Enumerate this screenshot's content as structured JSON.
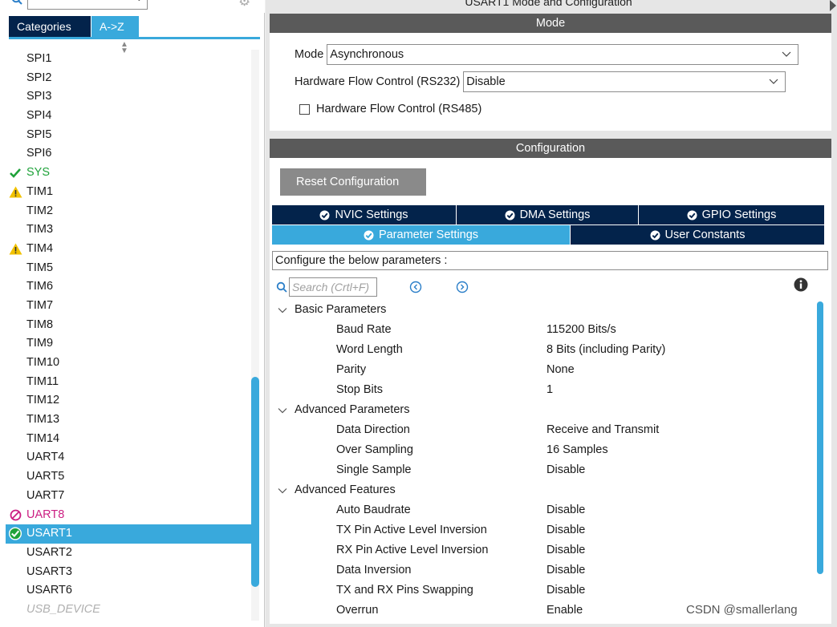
{
  "left": {
    "tabs": [
      "Categories",
      "A->Z"
    ],
    "peripherals": [
      {
        "label": "SPI1",
        "status": "none"
      },
      {
        "label": "SPI2",
        "status": "none"
      },
      {
        "label": "SPI3",
        "status": "none"
      },
      {
        "label": "SPI4",
        "status": "none"
      },
      {
        "label": "SPI5",
        "status": "none"
      },
      {
        "label": "SPI6",
        "status": "none"
      },
      {
        "label": "SYS",
        "status": "ok"
      },
      {
        "label": "TIM1",
        "status": "warning"
      },
      {
        "label": "TIM2",
        "status": "none"
      },
      {
        "label": "TIM3",
        "status": "none"
      },
      {
        "label": "TIM4",
        "status": "warning"
      },
      {
        "label": "TIM5",
        "status": "none"
      },
      {
        "label": "TIM6",
        "status": "none"
      },
      {
        "label": "TIM7",
        "status": "none"
      },
      {
        "label": "TIM8",
        "status": "none"
      },
      {
        "label": "TIM9",
        "status": "none"
      },
      {
        "label": "TIM10",
        "status": "none"
      },
      {
        "label": "TIM11",
        "status": "none"
      },
      {
        "label": "TIM12",
        "status": "none"
      },
      {
        "label": "TIM13",
        "status": "none"
      },
      {
        "label": "TIM14",
        "status": "none"
      },
      {
        "label": "UART4",
        "status": "none"
      },
      {
        "label": "UART5",
        "status": "none"
      },
      {
        "label": "UART7",
        "status": "none"
      },
      {
        "label": "UART8",
        "status": "error"
      },
      {
        "label": "USART1",
        "status": "selected"
      },
      {
        "label": "USART2",
        "status": "none"
      },
      {
        "label": "USART3",
        "status": "none"
      },
      {
        "label": "USART6",
        "status": "none"
      },
      {
        "label": "USB_DEVICE",
        "status": "disabled"
      }
    ]
  },
  "right": {
    "title": "USART1 Mode and Configuration",
    "mode_header": "Mode",
    "mode": {
      "label": "Mode",
      "value": "Asynchronous"
    },
    "hw_flow_rs232": {
      "label": "Hardware Flow Control (RS232)",
      "value": "Disable"
    },
    "hw_flow_rs485": {
      "label": "Hardware Flow Control (RS485)",
      "checked": false
    },
    "config_header": "Configuration",
    "reset_button": "Reset Configuration",
    "tabs_row1": [
      {
        "label": "NVIC Settings",
        "active": false
      },
      {
        "label": "DMA Settings",
        "active": false
      },
      {
        "label": "GPIO Settings",
        "active": false
      }
    ],
    "tabs_row2": [
      {
        "label": "Parameter Settings",
        "active": true
      },
      {
        "label": "User Constants",
        "active": false
      }
    ],
    "configure_label": "Configure the below parameters :",
    "search_placeholder": "Search (Crtl+F)",
    "groups": [
      {
        "name": "Basic Parameters",
        "params": [
          {
            "name": "Baud Rate",
            "value": "115200 Bits/s"
          },
          {
            "name": "Word Length",
            "value": "8 Bits (including Parity)"
          },
          {
            "name": "Parity",
            "value": "None"
          },
          {
            "name": "Stop Bits",
            "value": "1"
          }
        ]
      },
      {
        "name": "Advanced Parameters",
        "params": [
          {
            "name": "Data Direction",
            "value": "Receive and Transmit"
          },
          {
            "name": "Over Sampling",
            "value": "16 Samples"
          },
          {
            "name": "Single Sample",
            "value": "Disable"
          }
        ]
      },
      {
        "name": "Advanced Features",
        "params": [
          {
            "name": "Auto Baudrate",
            "value": "Disable"
          },
          {
            "name": "TX Pin Active Level Inversion",
            "value": "Disable"
          },
          {
            "name": "RX Pin Active Level Inversion",
            "value": "Disable"
          },
          {
            "name": "Data Inversion",
            "value": "Disable"
          },
          {
            "name": "TX and RX Pins Swapping",
            "value": "Disable"
          },
          {
            "name": "Overrun",
            "value": "Enable"
          }
        ]
      }
    ]
  },
  "watermark": "CSDN @smallerlang",
  "colors": {
    "dark_navy": "#03234b",
    "accent_blue": "#39a9dc",
    "ok_green": "#1fa23a",
    "warn_yellow": "#f2c200",
    "error_magenta": "#cc1f83",
    "header_gray": "#5a5a5a"
  }
}
